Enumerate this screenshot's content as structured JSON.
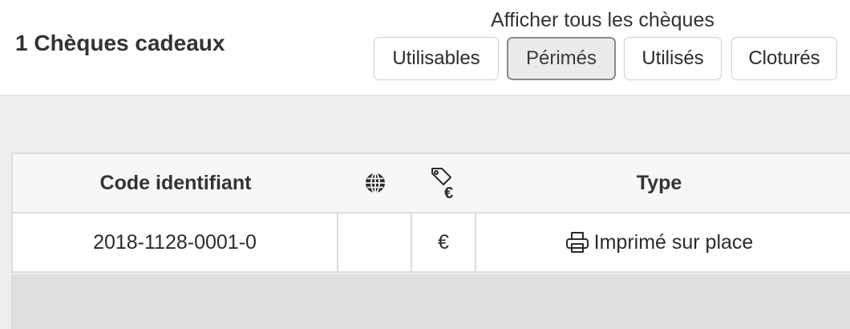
{
  "header": {
    "title": "1 Chèques cadeaux",
    "filter_caption": "Afficher tous les chèques",
    "filters": [
      {
        "label": "Utilisables",
        "active": false
      },
      {
        "label": "Périmés",
        "active": true
      },
      {
        "label": "Utilisés",
        "active": false
      },
      {
        "label": "Cloturés",
        "active": false
      }
    ]
  },
  "table": {
    "columns": {
      "code": "Code identifiant",
      "web_icon": "globe-icon",
      "price_icon": "price-tag-euro-icon",
      "type": "Type"
    },
    "rows": [
      {
        "code": "2018-1128-0001-0",
        "web": "",
        "currency": "€",
        "type_icon": "printer-icon",
        "type": "Imprimé sur place"
      }
    ]
  },
  "colors": {
    "active_filter_bg": "#ebebeb",
    "active_filter_border": "#8a8a8a",
    "content_bg": "#eeeeee",
    "table_header_bg": "#f7f7f7"
  }
}
